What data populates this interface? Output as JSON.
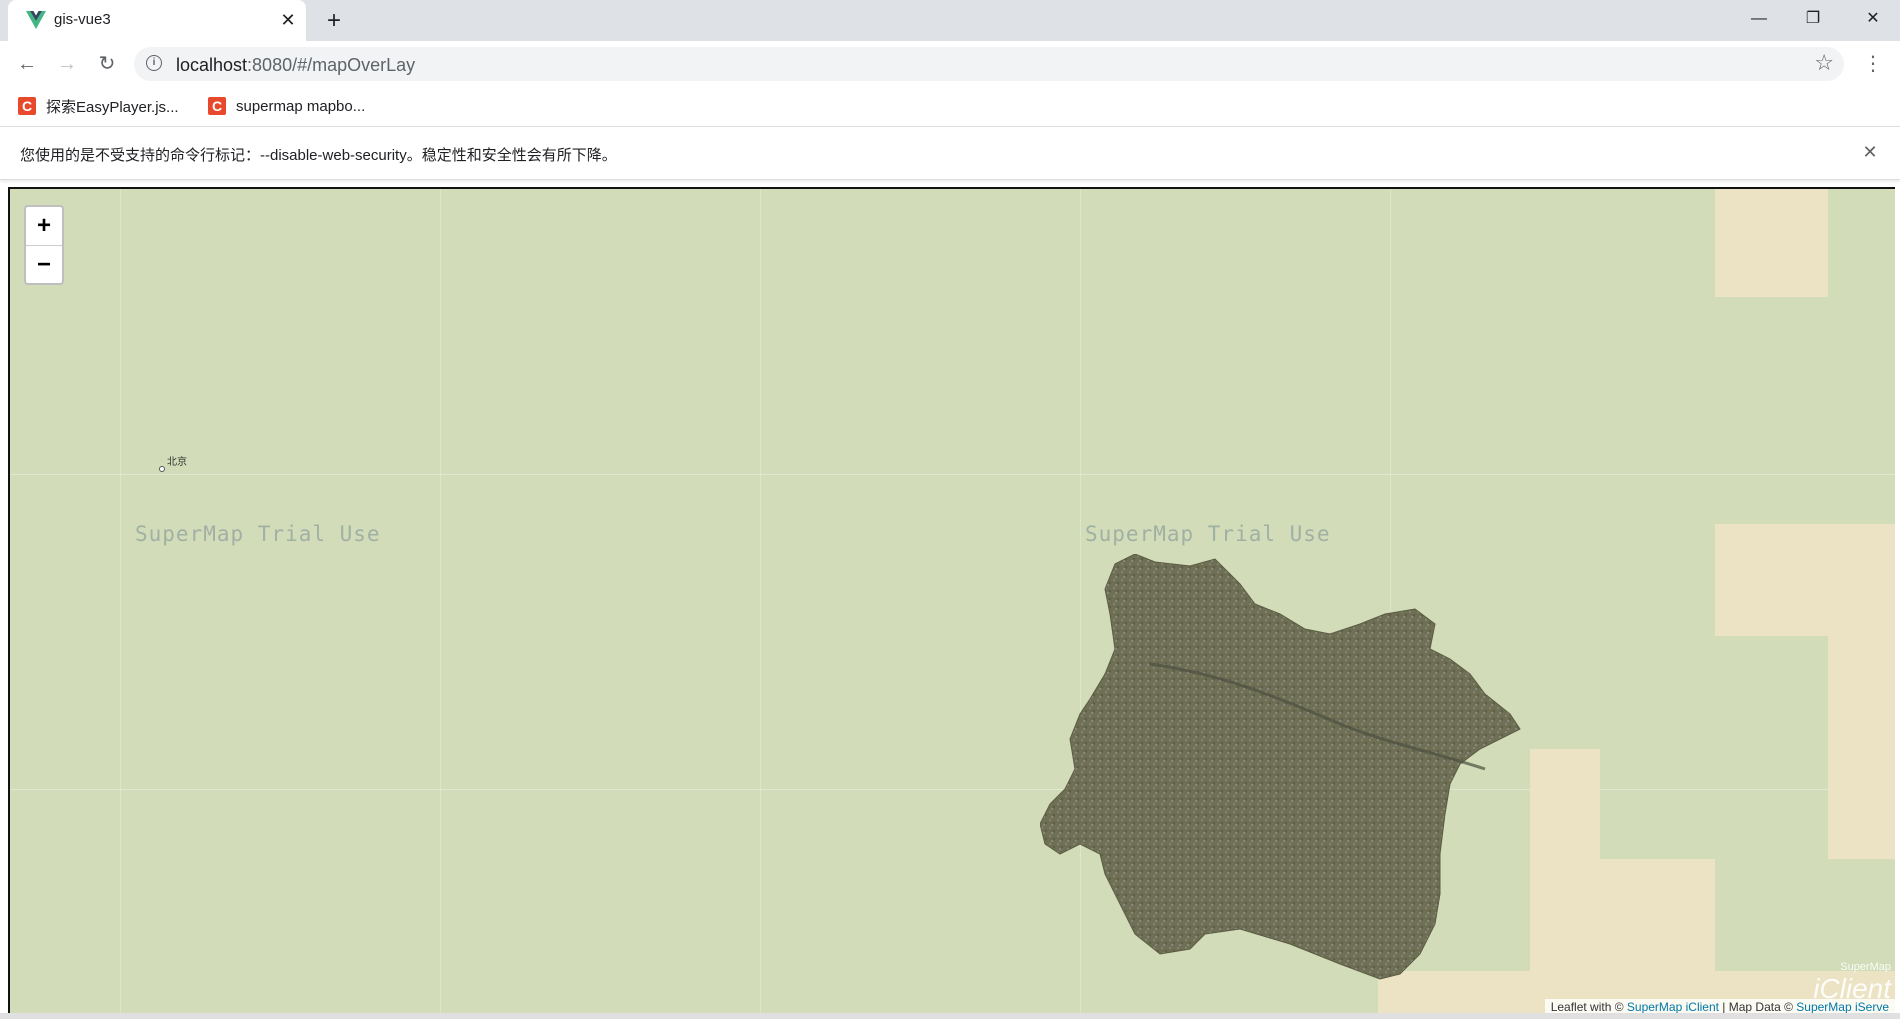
{
  "browser": {
    "tab_title": "gis-vue3",
    "tab_close": "✕",
    "new_tab": "+",
    "window": {
      "minimize": "—",
      "restore": "❐",
      "close": "✕"
    },
    "nav": {
      "back": "←",
      "forward": "→",
      "reload": "↻"
    },
    "url_host": "localhost",
    "url_rest": ":8080/#/mapOverLay",
    "star": "☆",
    "menu": "⋮"
  },
  "bookmarks": [
    {
      "icon": "C",
      "label": "探索EasyPlayer.js..."
    },
    {
      "icon": "C",
      "label": "supermap mapbo..."
    }
  ],
  "infobar": {
    "message": "您使用的是不受支持的命令行标记：--disable-web-security。稳定性和安全性会有所下降。",
    "close": "✕"
  },
  "map": {
    "zoom_in": "+",
    "zoom_out": "−",
    "city_label": "北京",
    "watermark": "SuperMap Trial Use",
    "logo_top": "SuperMap",
    "logo_main": "iClient",
    "attribution_prefix": "Leaflet with © ",
    "attribution_link1": "SuperMap iClient",
    "attribution_mid": " | Map Data © ",
    "attribution_link2": "SuperMap iServe",
    "colors": {
      "land": "#d2dcb8",
      "sand": "#ebe3c3",
      "overlay": "#6f6f55"
    }
  }
}
